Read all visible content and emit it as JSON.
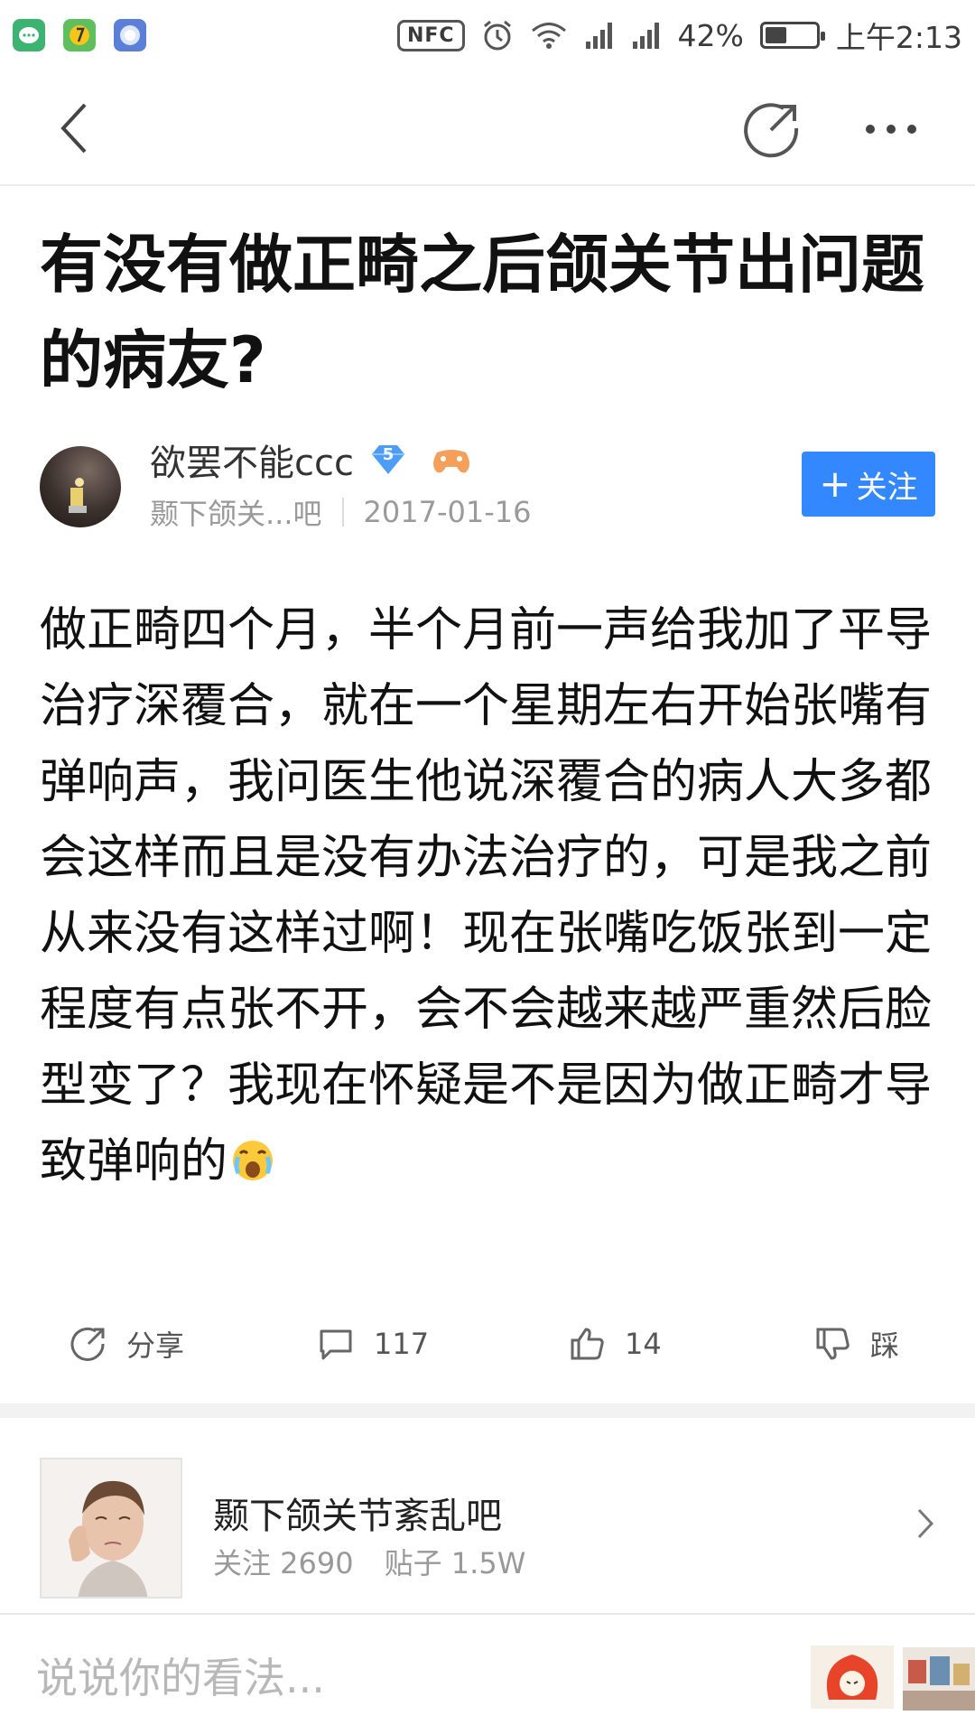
{
  "status_bar": {
    "apps": [
      {
        "icon": "message-app-icon",
        "color": "#3cb371"
      },
      {
        "icon": "music-app-icon",
        "color": "#f5c518"
      },
      {
        "icon": "browser-app-icon",
        "color": "#5b7fd6"
      }
    ],
    "nfc": "NFC",
    "battery_text": "42%",
    "battery_level": 0.42,
    "time": "上午2:13"
  },
  "nav": {
    "back_icon": "back-chevron-icon",
    "share_icon": "share-icon",
    "more_icon": "more-dots-icon"
  },
  "post": {
    "title": "有没有做正畸之后颌关节出问题的病友?",
    "author": {
      "name": "欲罢不能ccc",
      "level": "5",
      "forum_short": "颞下颌关...吧",
      "date": "2017-01-16"
    },
    "follow_label": "关注",
    "follow_plus": "+",
    "body": "做正畸四个月，半个月前一声给我加了平导治疗深覆合，就在一个星期左右开始张嘴有弹响声，我问医生他说深覆合的病人大多都会这样而且是没有办法治疗的，可是我之前从来没有这样过啊！现在张嘴吃饭张到一定程度有点张不开，会不会越来越严重然后脸型变了？我现在怀疑是不是因为做正畸才导致弹响的"
  },
  "actions": {
    "share_label": "分享",
    "comments_count": "117",
    "likes_count": "14",
    "dislike_label": "踩"
  },
  "forum": {
    "name": "颞下颌关节紊乱吧",
    "followers_label": "关注 2690",
    "posts_label": "贴子 1.5W"
  },
  "reply": {
    "placeholder": "说说你的看法..."
  },
  "colors": {
    "accent": "#3388ff",
    "muted_text": "#999999"
  }
}
